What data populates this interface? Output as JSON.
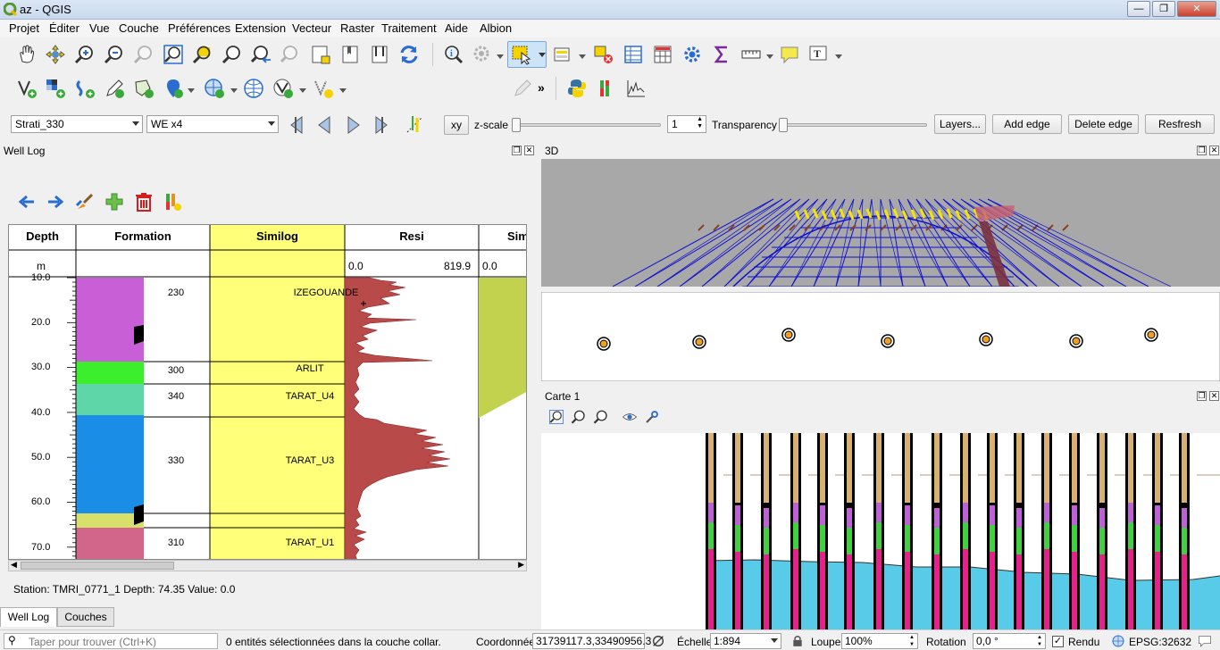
{
  "window": {
    "title": "az - QGIS"
  },
  "menu": [
    "Projet",
    "Éditer",
    "Vue",
    "Couche",
    "Préférences",
    "Extension",
    "Vecteur",
    "Raster",
    "Traitement",
    "Aide",
    "Albion"
  ],
  "plugin_toolbar": {
    "strati_combo": "Strati_330",
    "graph_combo": "WE x4",
    "xy_label": "xy",
    "zscale_label": "z-scale",
    "zscale_value": "1",
    "transparency_label": "Transparency",
    "layers_button": "Layers...",
    "add_edge_button": "Add edge",
    "delete_edge_button": "Delete edge",
    "refresh_button": "Resfresh"
  },
  "well_log": {
    "title": "Well Log",
    "columns": [
      "Depth",
      "Formation",
      "Similog",
      "Resi",
      "Sim"
    ],
    "depth_unit": "m",
    "resi_min": "0.0",
    "resi_max": "819.9",
    "sim_min": "0.0",
    "depth_ticks": [
      "10.0",
      "20.0",
      "30.0",
      "40.0",
      "50.0",
      "60.0",
      "70.0"
    ],
    "formations": [
      {
        "code": "230",
        "color": "#c95fd6"
      },
      {
        "code": "300",
        "color": "#3bef2c"
      },
      {
        "code": "340",
        "color": "#5fd6a8"
      },
      {
        "code": "330",
        "color": "#1a8de6"
      },
      {
        "code": "",
        "color": "#d6e06a"
      },
      {
        "code": "310",
        "color": "#d1658a"
      }
    ],
    "similog_labels": [
      "IZEGOUANDE",
      "ARLIT",
      "TARAT_U4",
      "TARAT_U3",
      "TARAT_U1"
    ],
    "status": "Station: TMRI_0771_1 Depth: 74.35 Value: 0.0"
  },
  "panel_3d": {
    "title": "3D"
  },
  "carte": {
    "title": "Carte 1"
  },
  "tabs": {
    "well_log": "Well Log",
    "couches": "Couches"
  },
  "statusbar": {
    "search_placeholder": "Taper pour trouver (Ctrl+K)",
    "selection_msg": "0 entités sélectionnées dans la couche collar.",
    "coord_label": "Coordonnée",
    "coord_value": "31739117.3,33490956.3",
    "scale_label": "Échelle",
    "scale_value": "1:894",
    "loupe_label": "Loupe",
    "loupe_value": "100%",
    "rotation_label": "Rotation",
    "rotation_value": "0,0 °",
    "render_label": "Rendu",
    "epsg": "EPSG:32632"
  },
  "colors": {
    "similog": "#ffff7a",
    "resi_fill": "#b84a4a",
    "sim_fill": "#c2d14e",
    "water": "#58cbe8",
    "qgis_green": "#589632"
  }
}
